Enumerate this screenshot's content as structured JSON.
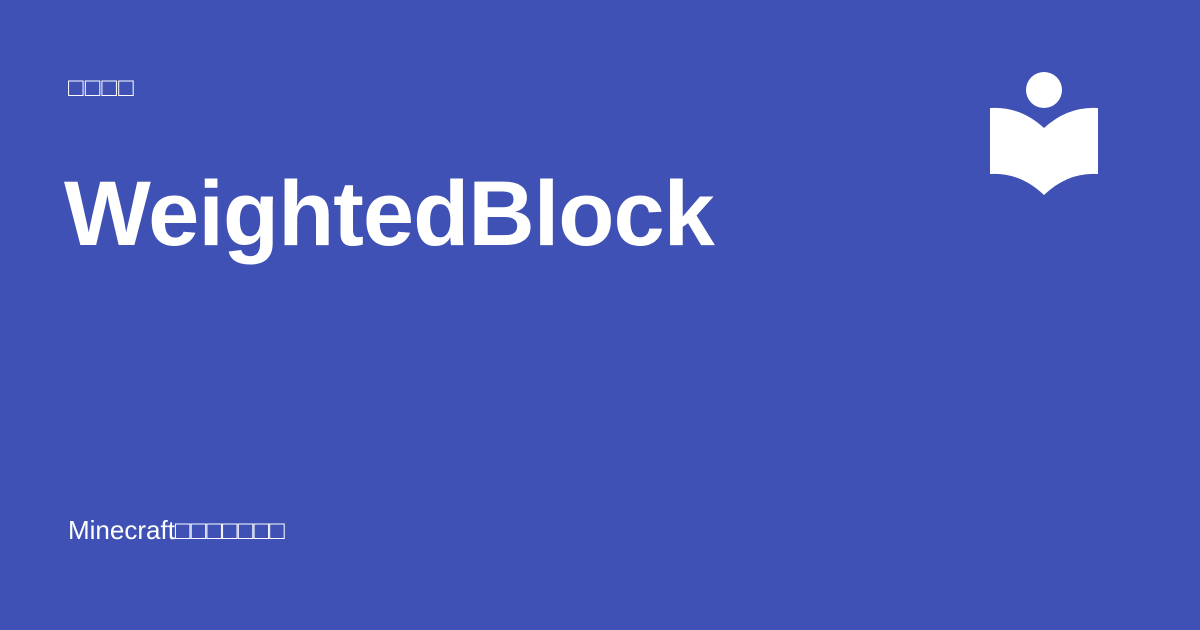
{
  "site": {
    "eyebrow": "□□□□",
    "title": "WeightedBlock",
    "footer": "Minecraft□□□□□□□"
  },
  "logo": {
    "icon": "reader-book-icon",
    "color": "#ffffff"
  },
  "colors": {
    "background": "#3f51b5",
    "text": "#ffffff"
  }
}
